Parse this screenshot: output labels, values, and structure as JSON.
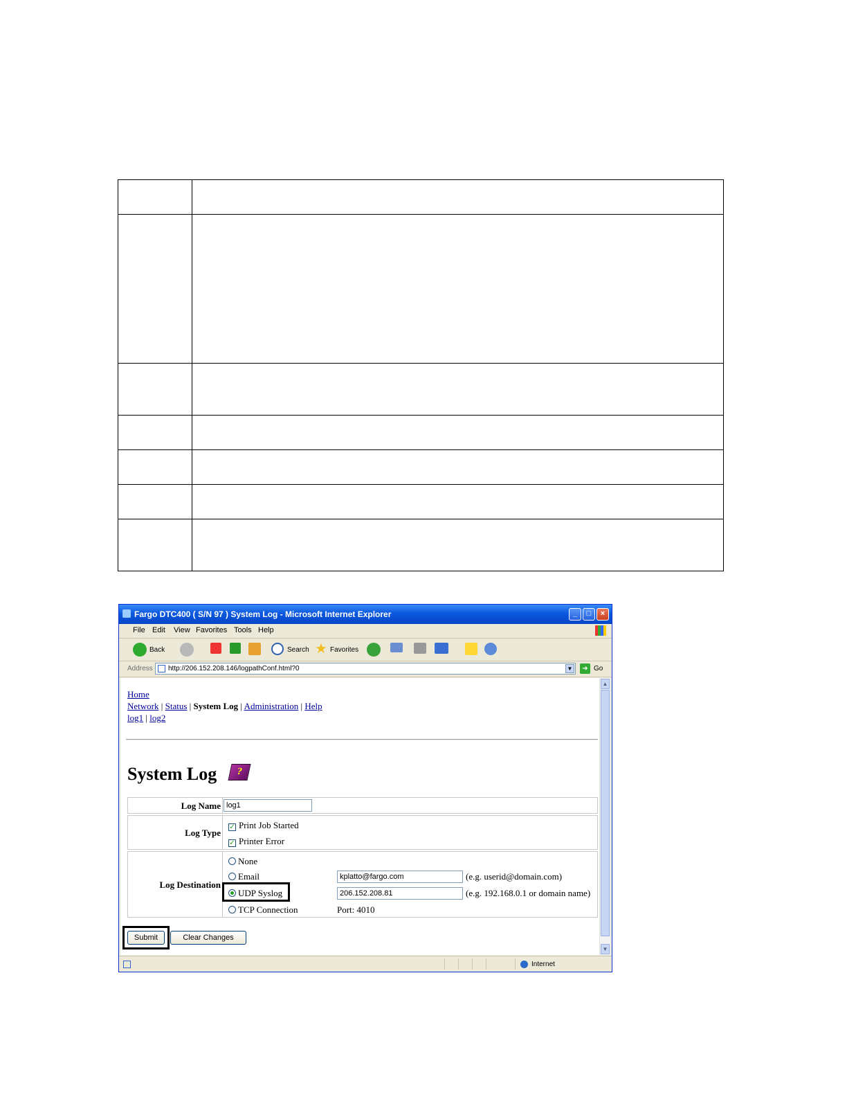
{
  "window": {
    "title": "Fargo DTC400 ( S/N 97 ) System Log - Microsoft Internet Explorer",
    "menu": [
      "File",
      "Edit",
      "View",
      "Favorites",
      "Tools",
      "Help"
    ],
    "toolbar": {
      "back": "Back",
      "search": "Search",
      "favorites": "Favorites"
    },
    "address_label": "Address",
    "address_url": "http://206.152.208.146/logpathConf.html?0",
    "go_label": "Go",
    "status_zone": "Internet"
  },
  "nav": {
    "home": "Home",
    "network": "Network",
    "status": "Status",
    "system_log": "System Log",
    "administration": "Administration",
    "help": "Help",
    "sep": "|",
    "log1": "log1",
    "log2": "log2"
  },
  "page": {
    "title": "System Log",
    "help_icon": "help-book-icon"
  },
  "form": {
    "log_name_label": "Log Name",
    "log_name_value": "log1",
    "log_type_label": "Log Type",
    "log_type_options": [
      {
        "label": "Print Job Started",
        "checked": true
      },
      {
        "label": "Printer Error",
        "checked": true
      }
    ],
    "log_destination_label": "Log Destination",
    "destinations": {
      "none": "None",
      "email": "Email",
      "udp": "UDP Syslog",
      "tcp": "TCP Connection"
    },
    "selected_destination": "UDP Syslog",
    "email_value": "kplatto@fargo.com",
    "email_hint": "(e.g. userid@domain.com)",
    "udp_value": "206.152.208.81",
    "udp_hint": "(e.g. 192.168.0.1 or domain name)",
    "tcp_port": "Port: 4010"
  },
  "buttons": {
    "submit": "Submit",
    "clear": "Clear Changes"
  }
}
